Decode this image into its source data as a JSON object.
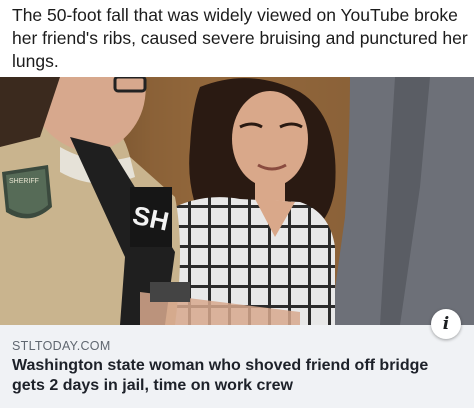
{
  "post": {
    "caption": "The 50-foot fall that was widely viewed on YouTube broke her friend's ribs, caused severe bruising and punctured her lungs."
  },
  "link_card": {
    "source": "STLTODAY.COM",
    "headline": "Washington state woman who shoved friend off bridge gets 2 days in jail, time on work crew",
    "info_icon": "i"
  },
  "photo": {
    "patch_text": "SHERIFF",
    "vest_text": "SH",
    "colors": {
      "wall": "#7a5533",
      "uniform": "#c9b48e",
      "hair": "#2a1a12",
      "blazer": "#6d7078"
    }
  }
}
